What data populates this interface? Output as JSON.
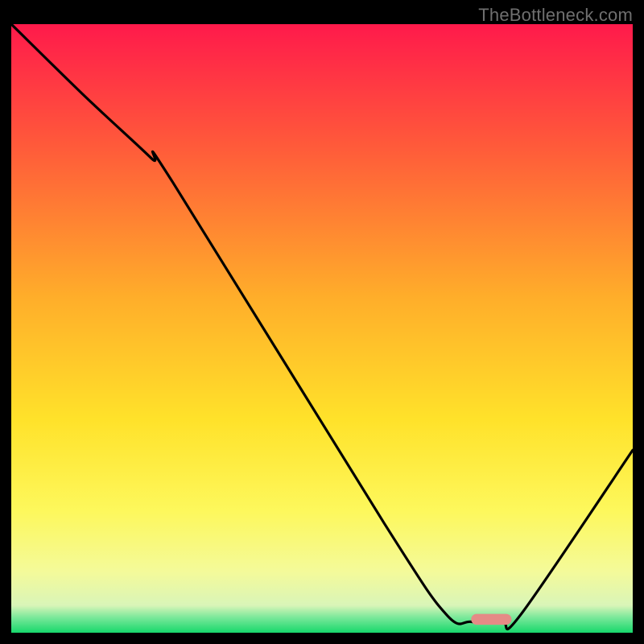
{
  "watermark": "TheBottleneck.com",
  "chart_data": {
    "type": "line",
    "title": "",
    "xlabel": "",
    "ylabel": "",
    "xlim": [
      0,
      100
    ],
    "ylim": [
      0,
      100
    ],
    "background_gradient": {
      "stops": [
        {
          "pos": 0.0,
          "color": "#ff1a4b"
        },
        {
          "pos": 0.2,
          "color": "#ff5a3a"
        },
        {
          "pos": 0.45,
          "color": "#ffae2a"
        },
        {
          "pos": 0.65,
          "color": "#ffe22a"
        },
        {
          "pos": 0.8,
          "color": "#fdf85c"
        },
        {
          "pos": 0.9,
          "color": "#f4fa9a"
        },
        {
          "pos": 0.955,
          "color": "#d9f5b8"
        },
        {
          "pos": 0.975,
          "color": "#7ae89a"
        },
        {
          "pos": 1.0,
          "color": "#17d86b"
        }
      ]
    },
    "curve": {
      "x": [
        0.0,
        12.0,
        22.5,
        26.0,
        60.0,
        70.0,
        74.0,
        79.0,
        82.0,
        100.0
      ],
      "y": [
        100.0,
        88.0,
        78.0,
        74.0,
        18.0,
        3.0,
        1.8,
        1.8,
        3.0,
        30.0
      ]
    },
    "marker": {
      "x_start": 74.0,
      "x_end": 80.5,
      "y": 2.2,
      "color": "#e58b86",
      "radius_pct": 0.9
    }
  }
}
